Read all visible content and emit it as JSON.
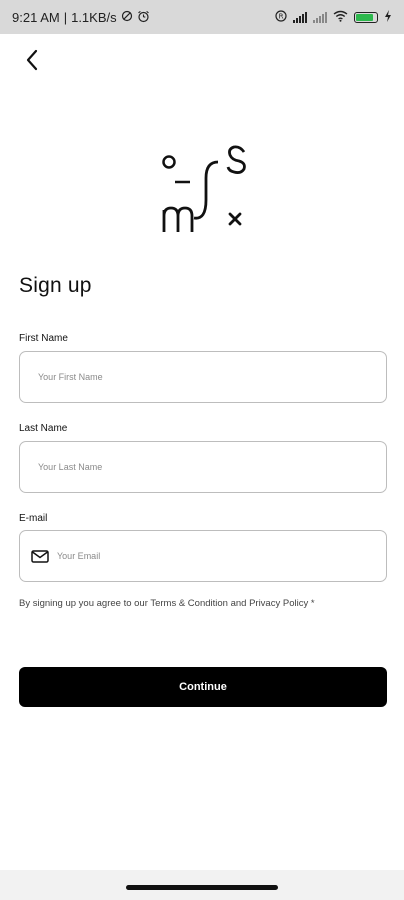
{
  "status_bar": {
    "time": "9:21 AM",
    "speed": "1.1KB/s",
    "separator": "|",
    "battery_color": "#2db84d"
  },
  "header": {
    "back_icon": "chevron-left-icon"
  },
  "logo": {
    "glyphs": [
      "o",
      "_",
      "m",
      "s",
      "x"
    ]
  },
  "page": {
    "title": "Sign up"
  },
  "form": {
    "first_name": {
      "label": "First Name",
      "placeholder": "Your First Name",
      "value": ""
    },
    "last_name": {
      "label": "Last Name",
      "placeholder": "Your Last Name",
      "value": ""
    },
    "email": {
      "label": "E-mail",
      "placeholder": "Your Email",
      "value": "",
      "icon": "mail-icon"
    }
  },
  "terms": {
    "text": "By signing up you agree to our Terms & Condition and Privacy Policy *"
  },
  "actions": {
    "continue_label": "Continue",
    "continue_bg": "#000000"
  }
}
